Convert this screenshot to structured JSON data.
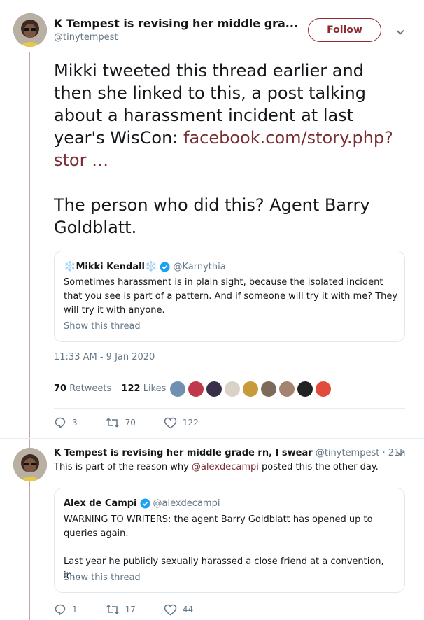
{
  "tweet1": {
    "display_name": "K Tempest is revising her middle gra...",
    "handle": "@tinytempest",
    "follow_label": "Follow",
    "body_text_1": "Mikki tweeted this thread earlier and then she linked to this, a post talking about a harassment incident at last year's WisCon: ",
    "body_link": "facebook.com/story.php?stor …",
    "body_text_2": "The person who did this? Agent Barry Goldblatt.",
    "quote": {
      "display_name": "Mikki Kendall",
      "name_prefix_emoji": "❄️",
      "name_suffix_emoji": "❄️",
      "handle": "@Karnythia",
      "text": "Sometimes harassment is in plain sight, because the isolated incident that you see is part of a pattern. And if someone will try it with me? They will try it with anyone.",
      "show_thread": "Show this thread"
    },
    "timestamp": "11:33 AM - 9 Jan 2020",
    "retweets_count": "70",
    "retweets_label": "Retweets",
    "likes_count": "122",
    "likes_label": "Likes",
    "action_replies": "3",
    "action_retweets": "70",
    "action_likes": "122"
  },
  "tweet2": {
    "display_name": "K Tempest is revising her middle grade rn, I swear",
    "handle_time": "@tinytempest · 21h",
    "body_prefix": "This is part of the reason why ",
    "body_mention": "@alexdecampi",
    "body_suffix": " posted this the other day.",
    "quote": {
      "display_name": "Alex de Campi",
      "handle": "@alexdecampi",
      "text_1": "WARNING TO WRITERS: the agent Barry Goldblatt has opened up to queries again.",
      "text_2": "Last year he publicly sexually harassed a close friend at a convention, in...",
      "show_thread": "Show this thread"
    },
    "action_replies": "1",
    "action_retweets": "17",
    "action_likes": "44"
  },
  "colors": {
    "link": "#7a2e33",
    "follow": "#8b2a2f",
    "verified": "#1da1f2",
    "thread_line": "#c6a3a6",
    "muted": "#657786"
  }
}
